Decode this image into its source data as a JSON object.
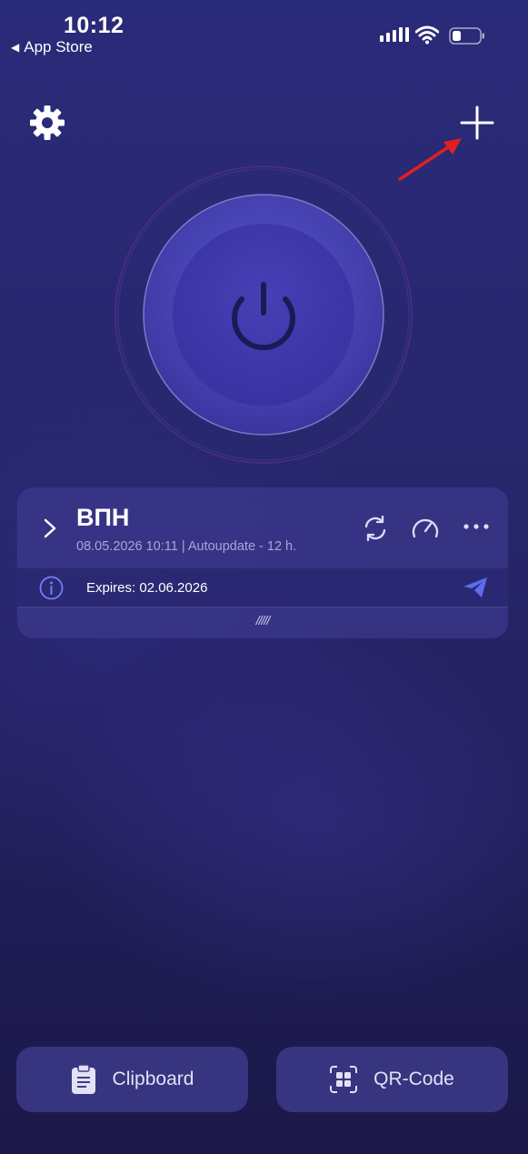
{
  "status_bar": {
    "time": "10:12",
    "back_label": "App Store",
    "back_glyph": "◀"
  },
  "header": {
    "settings_icon": "gear-icon",
    "add_icon": "plus-icon"
  },
  "connection": {
    "state": "disconnected",
    "icon": "power-icon"
  },
  "profile_card": {
    "title": "ВПН",
    "subtitle": "08.05.2026 10:11 | Autoupdate - 12 h.",
    "expires": "Expires: 02.06.2026",
    "drag_handle": "/////",
    "actions": [
      "refresh-icon",
      "speedometer-icon",
      "more-icon"
    ]
  },
  "bottom": {
    "clipboard_label": "Clipboard",
    "qr_label": "QR-Code"
  },
  "colors": {
    "accent": "#5b6cf0",
    "power_button": "#3e3aa8",
    "annotation_arrow": "#e02020"
  }
}
